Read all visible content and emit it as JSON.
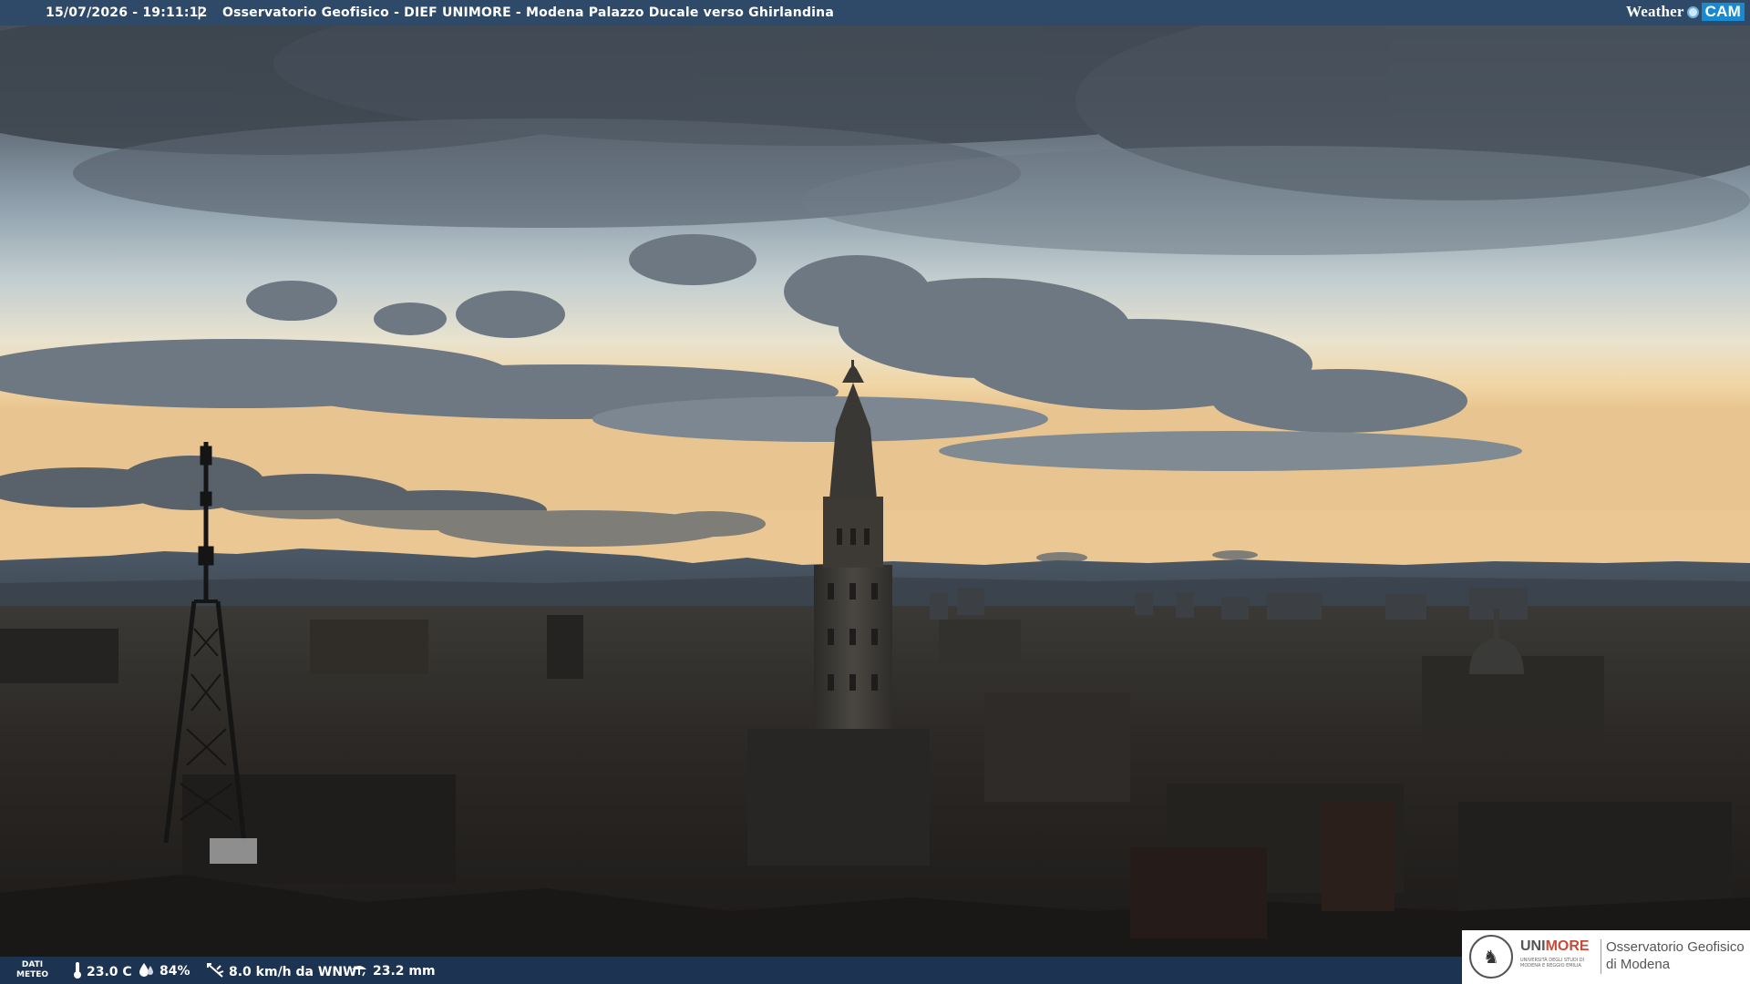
{
  "header": {
    "timestamp": "15/07/2026 - 19:11:12",
    "separator": "|",
    "title": "Osservatorio Geofisico - DIEF UNIMORE - Modena Palazzo Ducale verso Ghirlandina"
  },
  "brand": {
    "weather": "Weather",
    "cam": "CAM"
  },
  "weather": {
    "dati_label_line1": "DATI",
    "dati_label_line2": "METEO",
    "temperature": "23.0 C",
    "humidity": "84%",
    "wind": "8.0 km/h da WNW",
    "rain": "23.2 mm",
    "icons": [
      "thermometer-icon",
      "humidity-drop-icon",
      "wind-icon",
      "rain-icon"
    ]
  },
  "logo": {
    "unimore_part1": "UNI",
    "unimore_part2": "MORE",
    "unimore_sub": "UNIVERSITÀ DEGLI STUDI DI MODENA E REGGIO EMILIA",
    "observatory_line1": "Osservatorio Geofisico",
    "observatory_line2": "di Modena"
  },
  "colors": {
    "header_bg": "#2f4a68",
    "bottom_bar_bg": "#1c3758",
    "unimore_accent": "#c74b3b",
    "weathercam_blue": "#1a8ad0"
  }
}
